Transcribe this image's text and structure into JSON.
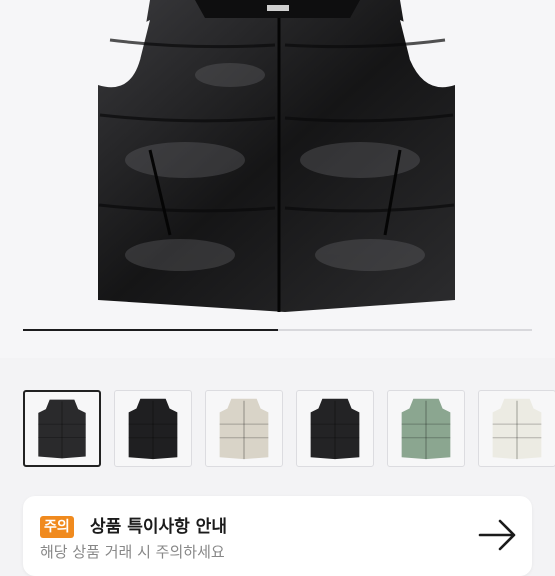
{
  "gallery": {
    "progress_fraction": 0.5,
    "thumbnails": [
      {
        "name": "black-vest-thumb",
        "color": "#2a2a2c",
        "selected": true
      },
      {
        "name": "black-vest-2-thumb",
        "color": "#1f1f21",
        "selected": false
      },
      {
        "name": "cream-vest-thumb",
        "color": "#d9d4c8",
        "selected": false
      },
      {
        "name": "black-vest-3-thumb",
        "color": "#232325",
        "selected": false
      },
      {
        "name": "green-vest-thumb",
        "color": "#8ba690",
        "selected": false
      },
      {
        "name": "ivory-vest-thumb",
        "color": "#ecebe3",
        "selected": false
      }
    ]
  },
  "notice": {
    "badge": "주의",
    "title": "상품 특이사항 안내",
    "subtitle": "해당 상품 거래 시 주의하세요"
  },
  "colors": {
    "accent": "#f08a1e",
    "background": "#f3f3f5"
  }
}
